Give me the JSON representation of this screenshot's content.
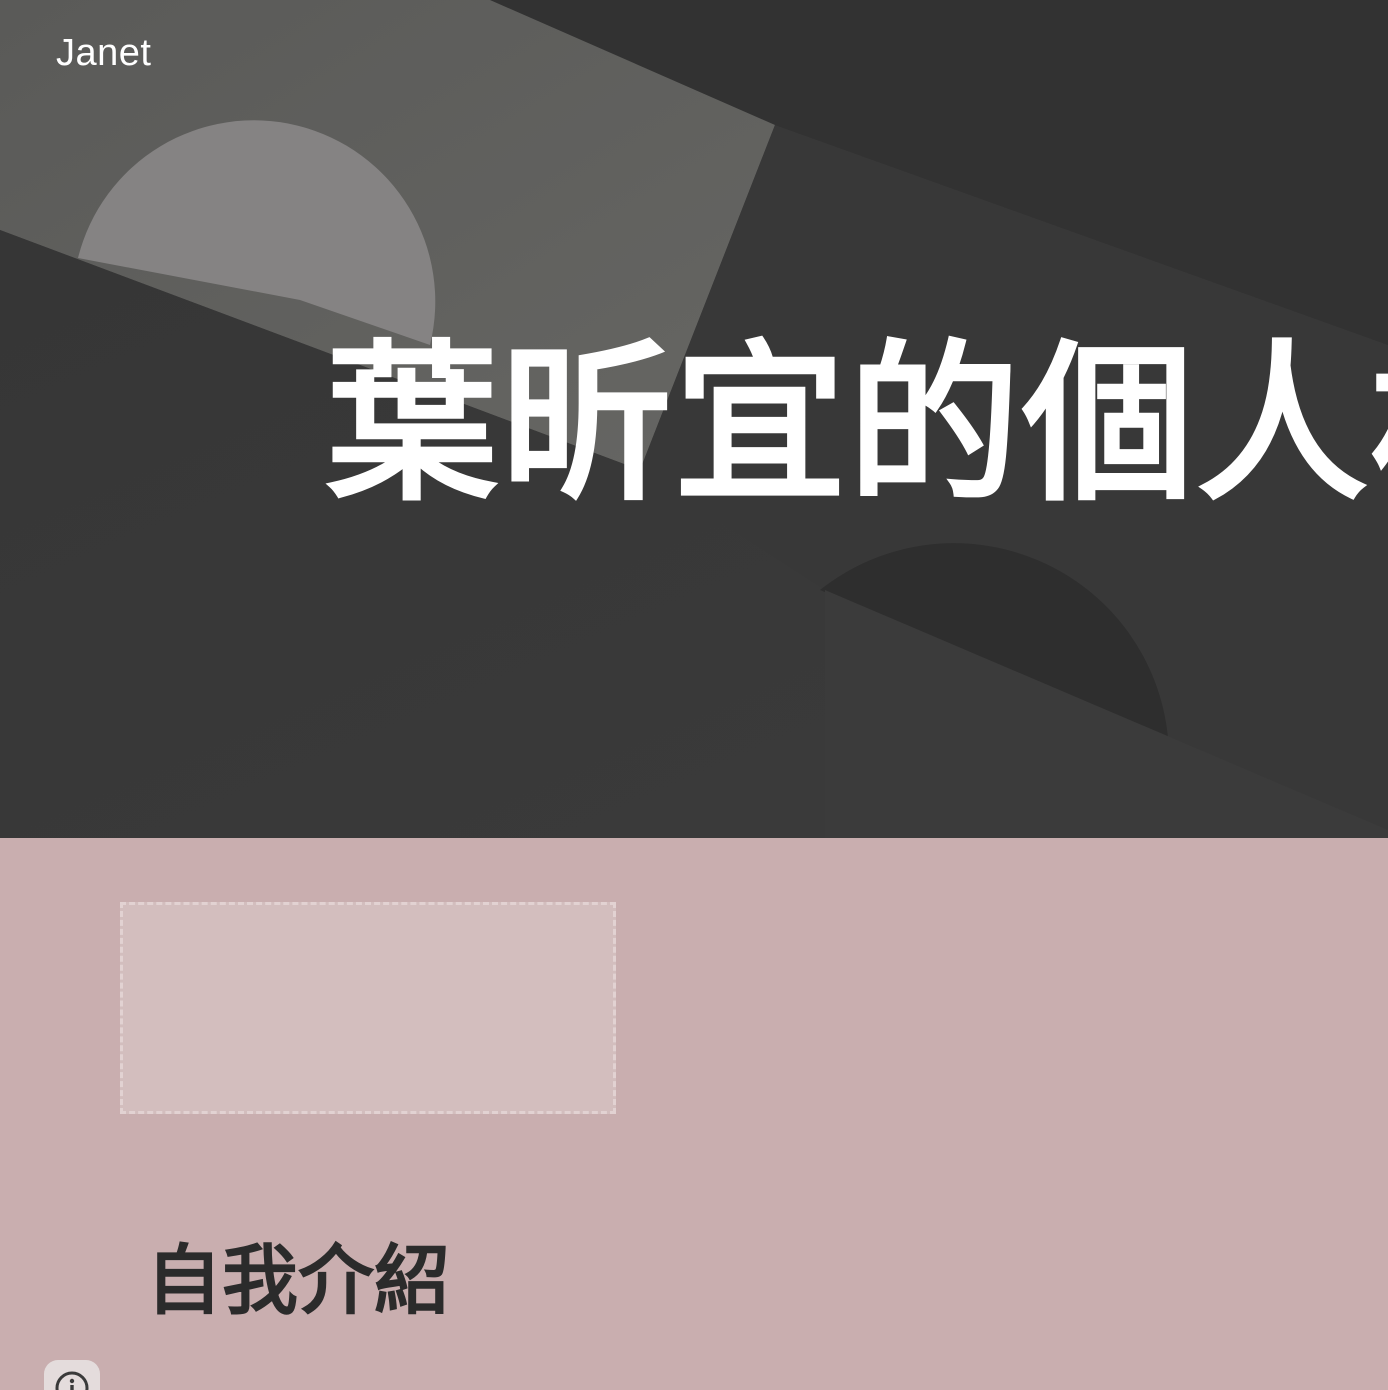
{
  "header": {
    "site_name": "Janet"
  },
  "hero": {
    "title": "葉昕宜的個人相"
  },
  "about": {
    "heading": "自我介紹"
  },
  "footer": {
    "info_icon": "info-icon"
  },
  "colors": {
    "hero_background": "#3a3a3a",
    "content_background": "#c9aeaf",
    "placeholder_fill": "#d3bebe",
    "heading_text": "#2b2b2b",
    "hero_text": "#ffffff"
  }
}
